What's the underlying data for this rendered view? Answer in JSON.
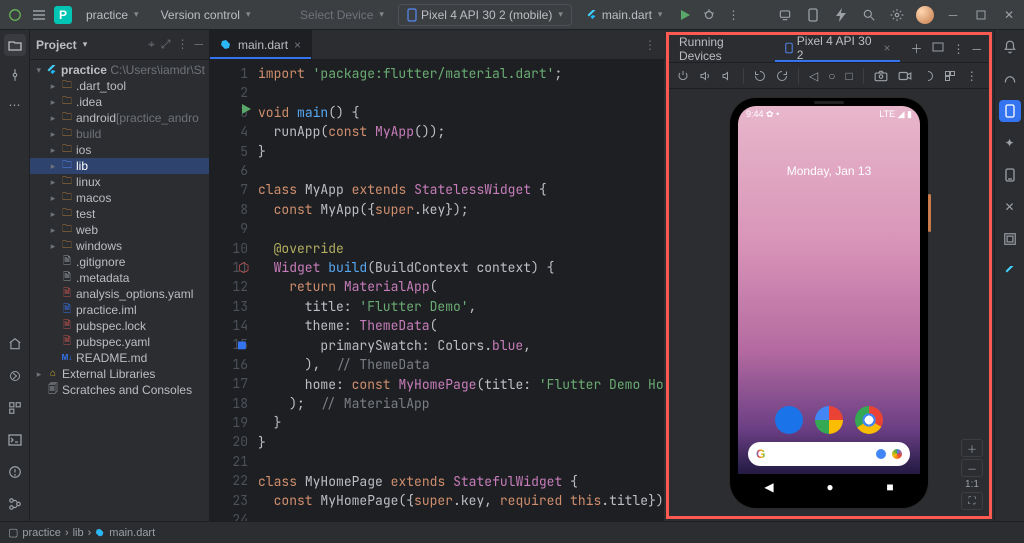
{
  "titlebar": {
    "project_initial": "P",
    "project_name": "practice",
    "vcs_label": "Version control",
    "select_device": "Select Device",
    "device_combo": "Pixel 4 API 30 2 (mobile)",
    "run_config": "main.dart"
  },
  "project_panel": {
    "title": "Project"
  },
  "tree": {
    "root": "practice",
    "root_path": "C:\\Users\\iamdr\\St",
    "dart_tool": ".dart_tool",
    "idea": ".idea",
    "android": "android",
    "android_suffix": " [practice_andro",
    "build": "build",
    "ios": "ios",
    "lib": "lib",
    "linux": "linux",
    "macos": "macos",
    "test": "test",
    "web": "web",
    "windows": "windows",
    "gitignore": ".gitignore",
    "metadata": ".metadata",
    "analysis": "analysis_options.yaml",
    "practice_iml": "practice.iml",
    "pubspec_lock": "pubspec.lock",
    "pubspec_yaml": "pubspec.yaml",
    "readme": "README.md",
    "ext_libs": "External Libraries",
    "scratches": "Scratches and Consoles"
  },
  "editor": {
    "tab": "main.dart",
    "lines": {
      "l1": "import 'package:flutter/material.dart';",
      "l2": "",
      "l3": "void main() {",
      "l4": "  runApp(const MyApp());",
      "l5": "}",
      "l6": "",
      "l7": "class MyApp extends StatelessWidget {",
      "l8": "  const MyApp({super.key});",
      "l9": "",
      "l10": "  @override",
      "l11": "  Widget build(BuildContext context) {",
      "l12": "    return MaterialApp(",
      "l13": "      title: 'Flutter Demo',",
      "l14": "      theme: ThemeData(",
      "l15": "        primarySwatch: Colors.blue,",
      "l16": "      ),  // ThemeData",
      "l17": "      home: const MyHomePage(title: 'Flutter Demo Home Page'),",
      "l18": "    );  // MaterialApp",
      "l19": "  }",
      "l20": "}",
      "l21": "",
      "l22": "class MyHomePage extends StatefulWidget {",
      "l23": "  const MyHomePage({super.key, required this.title});",
      "l24": ""
    }
  },
  "devices": {
    "title": "Running Devices",
    "tab": "Pixel 4 API 30 2",
    "zoom": "1:1"
  },
  "phone": {
    "time": "9:44",
    "signal": "LTE",
    "date": "Monday, Jan 13"
  },
  "statusline": {
    "p1": "practice",
    "p2": "lib",
    "p3": "main.dart"
  }
}
